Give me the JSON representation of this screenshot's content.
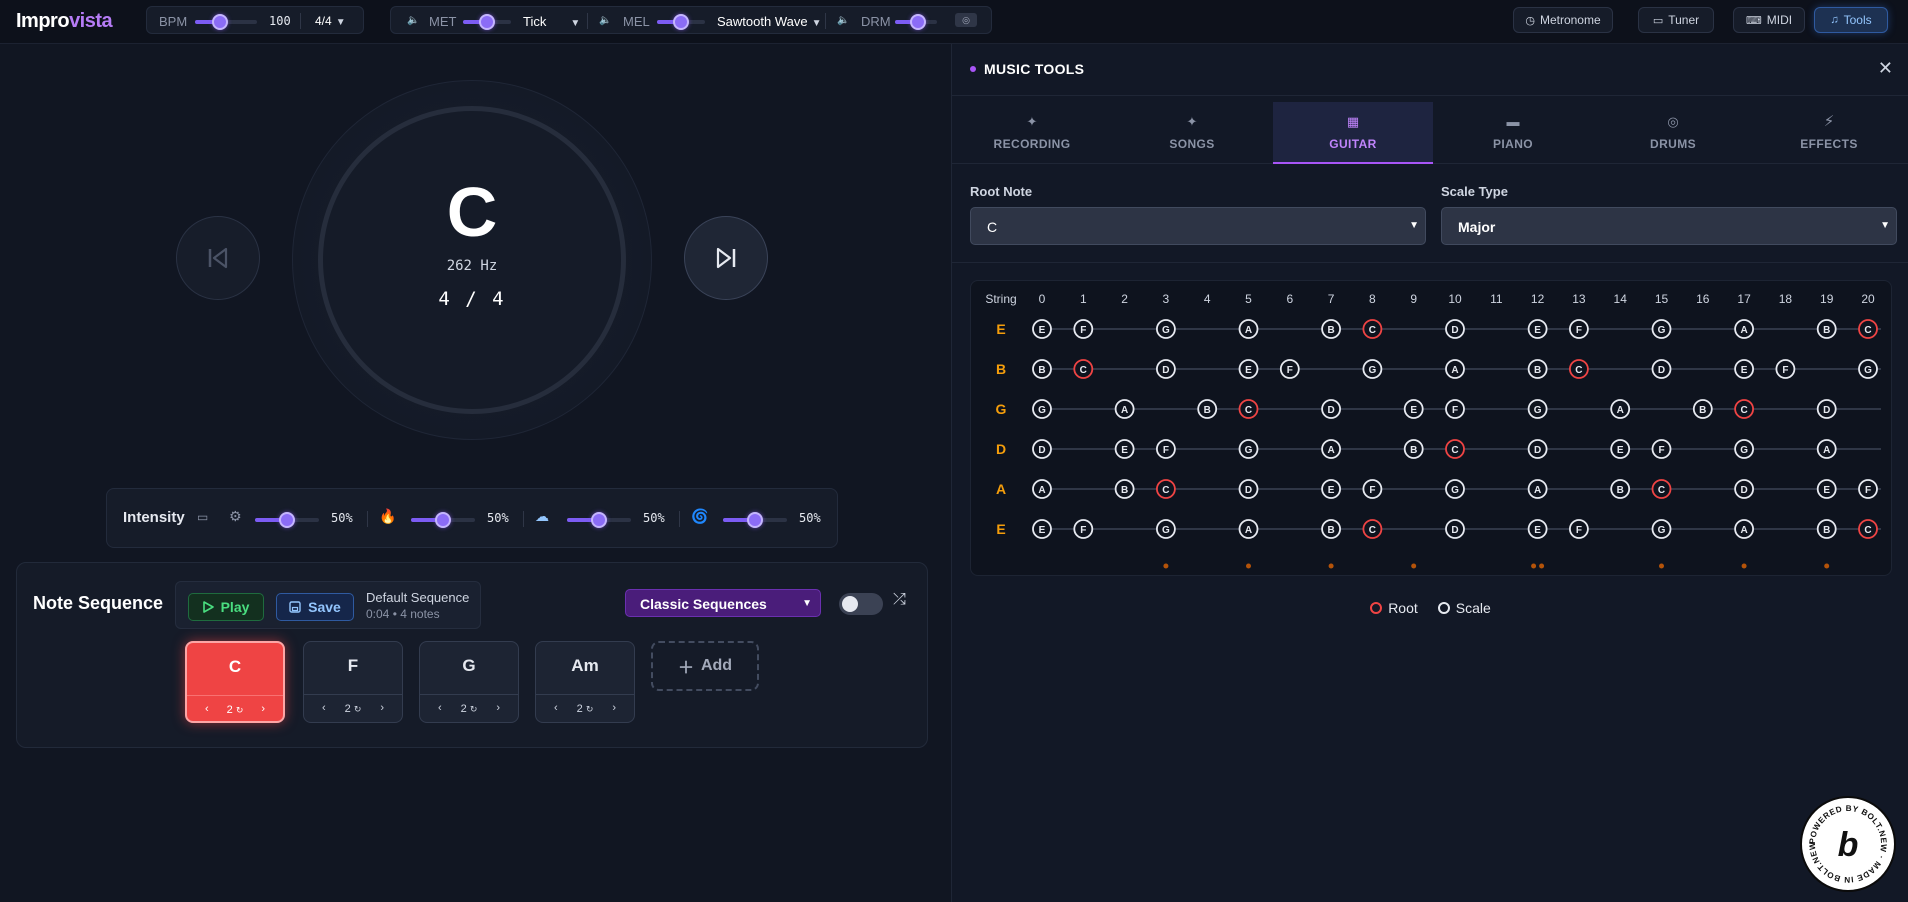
{
  "app": {
    "logo_part1": "Impro",
    "logo_part2": "vista"
  },
  "topbar": {
    "bpm_label": "BPM",
    "bpm_value": "100",
    "bpm_level": 0.4,
    "time_signature": "4/4",
    "met_label": "MET",
    "met_sound": "Tick",
    "met_level": 0.5,
    "mel_label": "MEL",
    "mel_sound": "Sawtooth Wave",
    "mel_level": 0.5,
    "drm_label": "DRM",
    "drm_level": 0.55
  },
  "nav": {
    "metronome": "Metronome",
    "tuner": "Tuner",
    "midi": "MIDI",
    "tools": "Tools"
  },
  "player": {
    "note": "C",
    "frequency": "262 Hz",
    "beat": "4 / 4"
  },
  "intensity": {
    "label": "Intensity",
    "sliders": [
      {
        "icon": "gear-icon",
        "value": "50%",
        "level": 0.5
      },
      {
        "icon": "flame-icon",
        "value": "50%",
        "level": 0.5
      },
      {
        "icon": "cloud-icon",
        "value": "50%",
        "level": 0.5
      },
      {
        "icon": "spiral-icon",
        "value": "50%",
        "level": 0.5
      }
    ]
  },
  "sequence": {
    "title": "Note Sequence",
    "play_label": "Play",
    "save_label": "Save",
    "name": "Default Sequence",
    "meta": "0:04 • 4 notes",
    "classic_label": "Classic Sequences",
    "add_label": "Add",
    "notes": [
      {
        "note": "C",
        "count": "2",
        "active": true
      },
      {
        "note": "F",
        "count": "2",
        "active": false
      },
      {
        "note": "G",
        "count": "2",
        "active": false
      },
      {
        "note": "Am",
        "count": "2",
        "active": false
      }
    ]
  },
  "tools": {
    "title": "MUSIC TOOLS",
    "tabs": [
      {
        "label": "RECORDING",
        "icon": "plus-sparkle-icon"
      },
      {
        "label": "SONGS",
        "icon": "plus-sparkle-icon"
      },
      {
        "label": "GUITAR",
        "icon": "guitar-icon",
        "active": true
      },
      {
        "label": "PIANO",
        "icon": "piano-icon"
      },
      {
        "label": "DRUMS",
        "icon": "drum-icon"
      },
      {
        "label": "EFFECTS",
        "icon": "bolt-icon"
      }
    ],
    "root_label": "Root Note",
    "root_value": "C",
    "scale_label": "Scale Type",
    "scale_value": "Major",
    "legend_root": "Root",
    "legend_scale": "Scale"
  },
  "fretboard": {
    "string_header": "String",
    "frets": [
      "0",
      "1",
      "2",
      "3",
      "4",
      "5",
      "6",
      "7",
      "8",
      "9",
      "10",
      "11",
      "12",
      "13",
      "14",
      "15",
      "16",
      "17",
      "18",
      "19",
      "20"
    ],
    "root": "C",
    "strings": [
      {
        "name": "E",
        "notes": [
          "E",
          "F",
          "",
          "G",
          "",
          "A",
          "",
          "B",
          "C",
          "",
          "D",
          "",
          "E",
          "F",
          "",
          "G",
          "",
          "A",
          "",
          "B",
          "C"
        ]
      },
      {
        "name": "B",
        "notes": [
          "B",
          "C",
          "",
          "D",
          "",
          "E",
          "F",
          "",
          "G",
          "",
          "A",
          "",
          "B",
          "C",
          "",
          "D",
          "",
          "E",
          "F",
          "",
          "G"
        ]
      },
      {
        "name": "G",
        "notes": [
          "G",
          "",
          "A",
          "",
          "B",
          "C",
          "",
          "D",
          "",
          "E",
          "F",
          "",
          "G",
          "",
          "A",
          "",
          "B",
          "C",
          "",
          "D",
          ""
        ]
      },
      {
        "name": "D",
        "notes": [
          "D",
          "",
          "E",
          "F",
          "",
          "G",
          "",
          "A",
          "",
          "B",
          "C",
          "",
          "D",
          "",
          "E",
          "F",
          "",
          "G",
          "",
          "A",
          ""
        ]
      },
      {
        "name": "A",
        "notes": [
          "A",
          "",
          "B",
          "C",
          "",
          "D",
          "",
          "E",
          "F",
          "",
          "G",
          "",
          "A",
          "",
          "B",
          "C",
          "",
          "D",
          "",
          "E",
          "F"
        ]
      },
      {
        "name": "E",
        "notes": [
          "E",
          "F",
          "",
          "G",
          "",
          "A",
          "",
          "B",
          "C",
          "",
          "D",
          "",
          "E",
          "F",
          "",
          "G",
          "",
          "A",
          "",
          "B",
          "C"
        ]
      }
    ],
    "markers": [
      3,
      5,
      7,
      9,
      12,
      15,
      17,
      19
    ]
  },
  "colors": {
    "accent": "#8b5cf6",
    "root": "#ef4444",
    "string_label": "#f59e0b",
    "marker": "#b45309"
  }
}
